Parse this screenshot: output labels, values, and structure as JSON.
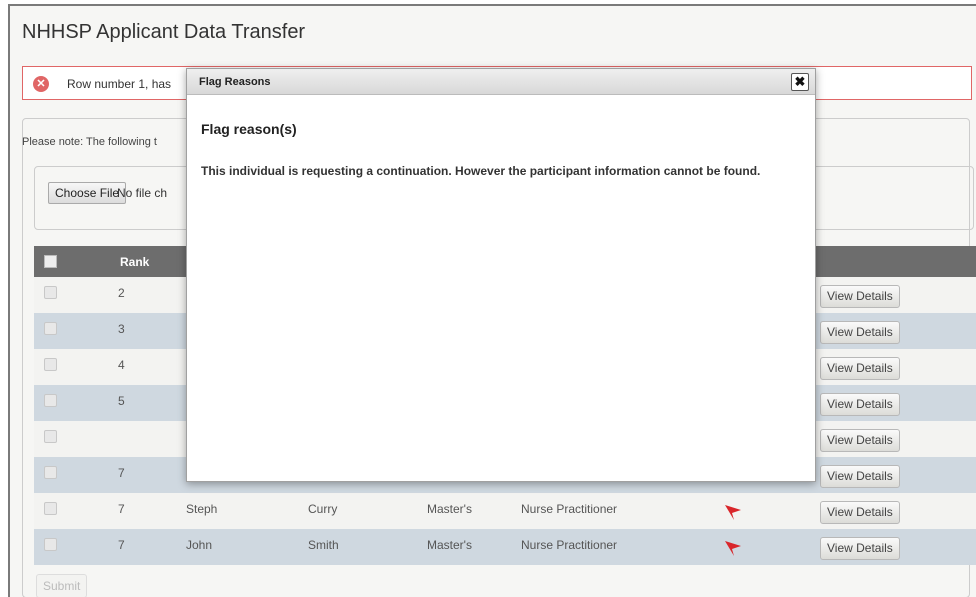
{
  "page": {
    "title": "NHHSP Applicant Data Transfer"
  },
  "alert": {
    "text": "Row number 1, has"
  },
  "upload": {
    "note": "Please note: The following t",
    "choose_label": "Choose File",
    "file_status": "No file ch"
  },
  "table": {
    "rank_header": "Rank",
    "rows": [
      {
        "rank": "2",
        "first": "",
        "last": "",
        "degree": "",
        "profession": "",
        "action": "View Details"
      },
      {
        "rank": "3",
        "first": "",
        "last": "",
        "degree": "",
        "profession": "",
        "action": "View Details"
      },
      {
        "rank": "4",
        "first": "",
        "last": "",
        "degree": "",
        "profession": "",
        "action": "View Details"
      },
      {
        "rank": "5",
        "first": "",
        "last": "",
        "degree": "",
        "profession": "",
        "action": "View Details"
      },
      {
        "rank": "",
        "first": "",
        "last": "",
        "degree": "",
        "profession": "",
        "action": "View Details"
      },
      {
        "rank": "7",
        "first": "",
        "last": "",
        "degree": "",
        "profession": "",
        "action": "View Details"
      },
      {
        "rank": "7",
        "first": "Steph",
        "last": "Curry",
        "degree": "Master's",
        "profession": "Nurse Practitioner",
        "flagged": true,
        "action": "View Details"
      },
      {
        "rank": "7",
        "first": "John",
        "last": "Smith",
        "degree": "Master's",
        "profession": "Nurse Practitioner",
        "flagged": true,
        "action": "View Details"
      }
    ]
  },
  "submit_label": "Submit",
  "modal": {
    "title": "Flag Reasons",
    "heading": "Flag reason(s)",
    "body": "This individual is requesting a continuation. However the participant information cannot be found.",
    "close_glyph": "✖"
  },
  "colors": {
    "flag": "#d9262b",
    "header_row": "#6d6d6d",
    "alt_row": "#cfd8e0",
    "alert_border": "#e06666"
  }
}
